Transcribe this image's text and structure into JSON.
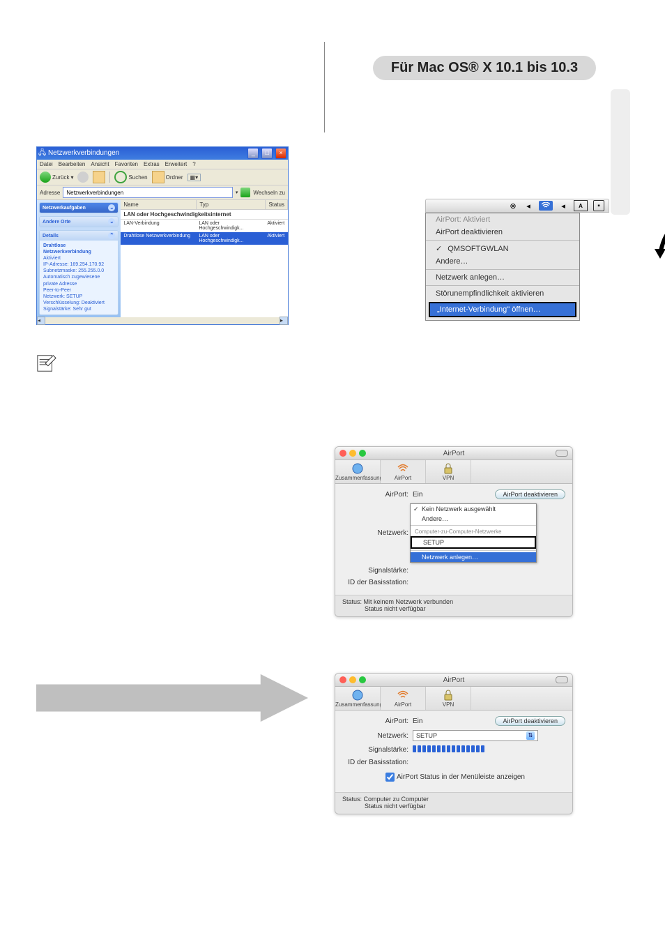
{
  "heading": "Für Mac OS® X 10.1 bis 10.3",
  "xp_window": {
    "title": "Netzwerkverbindungen",
    "menu": [
      "Datei",
      "Bearbeiten",
      "Ansicht",
      "Favoriten",
      "Extras",
      "Erweitert",
      "?"
    ],
    "toolbar": {
      "back": "Zurück",
      "search": "Suchen",
      "folders": "Ordner",
      "go": "Wechseln zu"
    },
    "address_label": "Adresse",
    "address_value": "Netzwerkverbindungen",
    "side": {
      "tasks_title": "Netzwerkaufgaben",
      "other_title": "Andere Orte",
      "details_title": "Details",
      "details_heading": "Drahtlose Netzwerkverbindung",
      "details_lines": [
        "Aktiviert",
        "IP-Adresse: 169.254.170.92",
        "Subnetzmaske: 255.255.0.0",
        "Automatisch zugewiesene private Adresse",
        "Peer-to-Peer",
        "Netzwerk: SETUP",
        "Verschlüsselung: Deaktiviert",
        "Signalstärke: Sehr gut"
      ]
    },
    "columns": [
      "Name",
      "Typ",
      "Status"
    ],
    "group": "LAN oder Hochgeschwindigkeitsinternet",
    "rows": [
      {
        "name": "LAN-Verbindung",
        "type": "LAN oder Hochgeschwindigk...",
        "status": "Aktiviert",
        "selected": false
      },
      {
        "name": "Drahtlose Netzwerkverbindung",
        "type": "LAN oder Hochgeschwindigk...",
        "status": "Aktiviert",
        "selected": true
      }
    ]
  },
  "mac_menu": {
    "status": "AirPort: Aktiviert",
    "deactivate": "AirPort deaktivieren",
    "network": "QMSOFTGWLAN",
    "other": "Andere…",
    "create": "Netzwerk anlegen…",
    "interference": "Störunempfindlichkeit aktivieren",
    "open": "„Internet-Verbindung\" öffnen…"
  },
  "mac_win1": {
    "title": "AirPort",
    "tabs": [
      "Zusammenfassung",
      "AirPort",
      "VPN"
    ],
    "labels": {
      "airport": "AirPort:",
      "network": "Netzwerk:",
      "signal": "Signalstärke:",
      "baseid": "ID der Basisstation:"
    },
    "airport_value": "Ein",
    "deact_btn": "AirPort deaktivieren",
    "popup": {
      "empty": "Kein Netzwerk ausgewählt",
      "other": "Andere…",
      "header": "Computer-zu-Computer-Netzwerke",
      "setup": "SETUP",
      "create": "Netzwerk anlegen…"
    },
    "status1": "Status: Mit keinem Netzwerk verbunden",
    "status2": "Status nicht verfügbar"
  },
  "mac_win2": {
    "title": "AirPort",
    "tabs": [
      "Zusammenfassung",
      "AirPort",
      "VPN"
    ],
    "labels": {
      "airport": "AirPort:",
      "network": "Netzwerk:",
      "signal": "Signalstärke:",
      "baseid": "ID der Basisstation:"
    },
    "airport_value": "Ein",
    "deact_btn": "AirPort deaktivieren",
    "network_value": "SETUP",
    "show_menubar": "AirPort Status in der Menüleiste anzeigen",
    "status1": "Status: Computer zu Computer",
    "status2": "Status nicht verfügbar"
  },
  "colors": {
    "red": "#ff5f57",
    "yellow": "#febc2e",
    "green": "#28c840"
  }
}
